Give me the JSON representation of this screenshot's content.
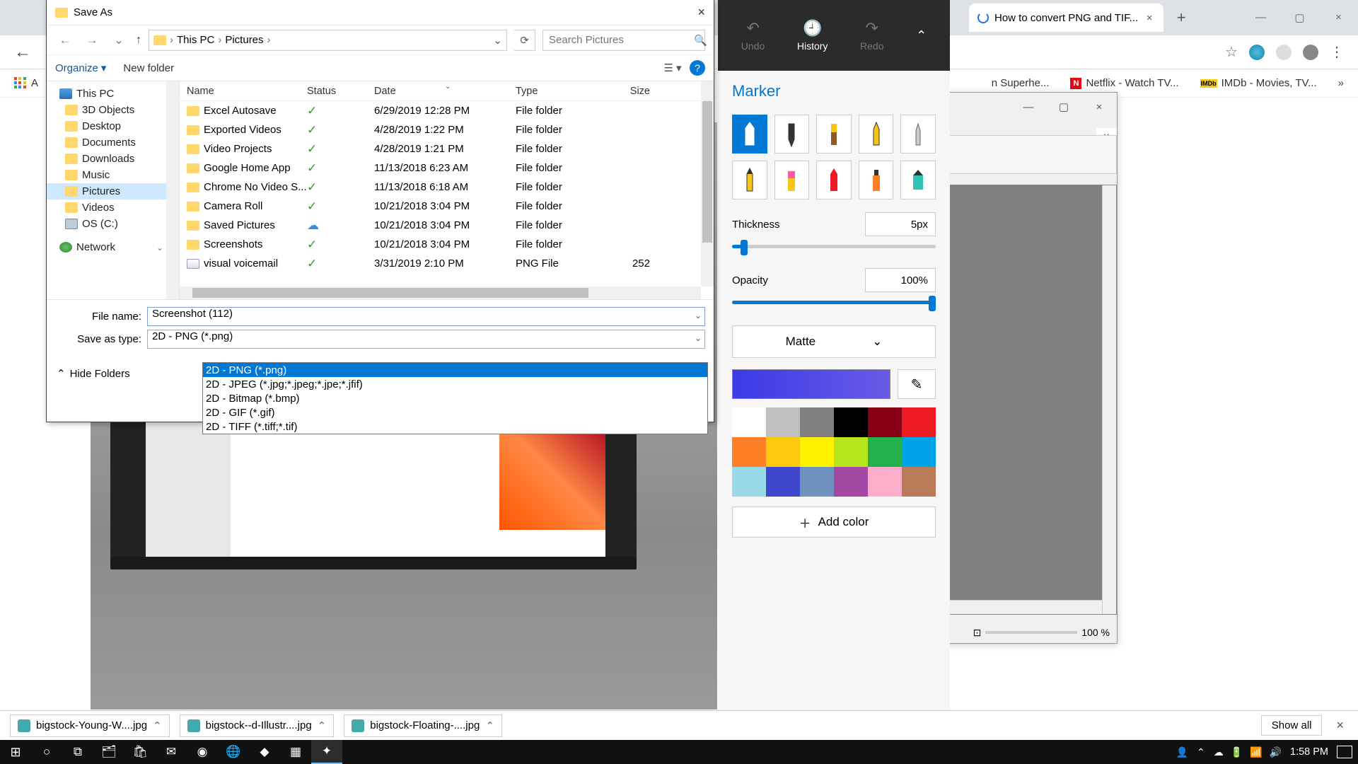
{
  "chrome": {
    "tab_title": "How to convert PNG and TIF...",
    "bookmarks": {
      "apps": "A",
      "superhero": "n Superhe...",
      "netflix": "Netflix - Watch TV...",
      "imdb": "IMDb - Movies, TV..."
    }
  },
  "paint_window": {
    "zoom": "100 %"
  },
  "marker": {
    "top": {
      "undo": "Undo",
      "history": "History",
      "redo": "Redo"
    },
    "title": "Marker",
    "thickness_label": "Thickness",
    "thickness_value": "5px",
    "opacity_label": "Opacity",
    "opacity_value": "100%",
    "finish": "Matte",
    "add_color": "Add color",
    "swatches": [
      "#ffffff",
      "#c0c0c0",
      "#808080",
      "#000000",
      "#880015",
      "#ed1c24",
      "#ff7f27",
      "#ffc90e",
      "#fff200",
      "#b5e61d",
      "#22b14c",
      "#00a2e8",
      "#99d9ea",
      "#3f48cc",
      "#7092be",
      "#a349a4",
      "#ffaec9",
      "#b97a57"
    ]
  },
  "saveas": {
    "title": "Save As",
    "path": {
      "thispc": "This PC",
      "pictures": "Pictures"
    },
    "search_placeholder": "Search Pictures",
    "organize": "Organize",
    "new_folder": "New folder",
    "headers": {
      "name": "Name",
      "status": "Status",
      "date": "Date",
      "type": "Type",
      "size": "Size"
    },
    "tree": {
      "thispc": "This PC",
      "objects3d": "3D Objects",
      "desktop": "Desktop",
      "documents": "Documents",
      "downloads": "Downloads",
      "music": "Music",
      "pictures": "Pictures",
      "videos": "Videos",
      "osdrive": "OS (C:)",
      "network": "Network"
    },
    "rows": [
      {
        "name": "Excel Autosave",
        "status": "sync",
        "date": "6/29/2019 12:28 PM",
        "type": "File folder",
        "size": ""
      },
      {
        "name": "Exported Videos",
        "status": "sync",
        "date": "4/28/2019 1:22 PM",
        "type": "File folder",
        "size": ""
      },
      {
        "name": "Video Projects",
        "status": "sync",
        "date": "4/28/2019 1:21 PM",
        "type": "File folder",
        "size": ""
      },
      {
        "name": "Google Home App",
        "status": "sync",
        "date": "11/13/2018 6:23 AM",
        "type": "File folder",
        "size": ""
      },
      {
        "name": "Chrome No Video S...",
        "status": "sync",
        "date": "11/13/2018 6:18 AM",
        "type": "File folder",
        "size": ""
      },
      {
        "name": "Camera Roll",
        "status": "sync",
        "date": "10/21/2018 3:04 PM",
        "type": "File folder",
        "size": ""
      },
      {
        "name": "Saved Pictures",
        "status": "cloud",
        "date": "10/21/2018 3:04 PM",
        "type": "File folder",
        "size": ""
      },
      {
        "name": "Screenshots",
        "status": "sync",
        "date": "10/21/2018 3:04 PM",
        "type": "File folder",
        "size": ""
      },
      {
        "name": "visual voicemail",
        "status": "sync",
        "date": "3/31/2019 2:10 PM",
        "type": "PNG File",
        "size": "252",
        "icon": "png"
      }
    ],
    "filename_label": "File name:",
    "filename_value": "Screenshot (112)",
    "savetype_label": "Save as type:",
    "savetype_value": "2D - PNG (*.png)",
    "type_options": [
      "2D - PNG (*.png)",
      "2D - JPEG (*.jpg;*.jpeg;*.jpe;*.jfif)",
      "2D - Bitmap (*.bmp)",
      "2D - GIF (*.gif)",
      "2D - TIFF (*.tiff;*.tif)"
    ],
    "hide_folders": "Hide Folders"
  },
  "downloads": {
    "items": [
      "bigstock-Young-W....jpg",
      "bigstock--d-Illustr....jpg",
      "bigstock-Floating-....jpg"
    ],
    "show_all": "Show all"
  },
  "taskbar": {
    "time": "1:58 PM"
  }
}
